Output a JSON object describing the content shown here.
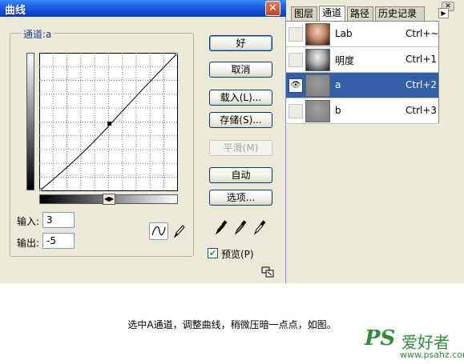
{
  "dialog": {
    "title": "曲线",
    "channel_label": "通道:a",
    "input_label": "输入:",
    "input_value": "3",
    "output_label": "输出:",
    "output_value": "-5",
    "buttons": {
      "ok": "好",
      "cancel": "取消",
      "load": "载入(L)...",
      "save": "存储(S)...",
      "smooth": "平滑(M)",
      "auto": "自动",
      "options": "选项..."
    },
    "preview_label": "预览(P)",
    "preview_checked": true,
    "curve_point": {
      "input": 3,
      "output": -5
    },
    "icons": [
      "close-icon",
      "curve-tool-icon",
      "pencil-icon",
      "black-eyedropper-icon",
      "gray-eyedropper-icon",
      "white-eyedropper-icon",
      "resize-icon"
    ]
  },
  "palette": {
    "tabs": [
      "图层",
      "通道",
      "路径",
      "历史记录"
    ],
    "active_tab": "通道",
    "channels": [
      {
        "name": "Lab",
        "shortcut": "Ctrl+~",
        "visible": false,
        "selected": false
      },
      {
        "name": "明度",
        "shortcut": "Ctrl+1",
        "visible": false,
        "selected": false
      },
      {
        "name": "a",
        "shortcut": "Ctrl+2",
        "visible": true,
        "selected": true
      },
      {
        "name": "b",
        "shortcut": "Ctrl+3",
        "visible": false,
        "selected": false
      }
    ],
    "colors": {
      "selected_row": "#335ea8",
      "dialog_bg": "#ece9d8",
      "title_blue": "#0f4bd3"
    }
  },
  "caption": "选中A通道，调整曲线，稍微压暗一点点，如图。",
  "watermark": {
    "ps": "PS",
    "cn": "爱好者",
    "url": "www.psahz.com"
  }
}
